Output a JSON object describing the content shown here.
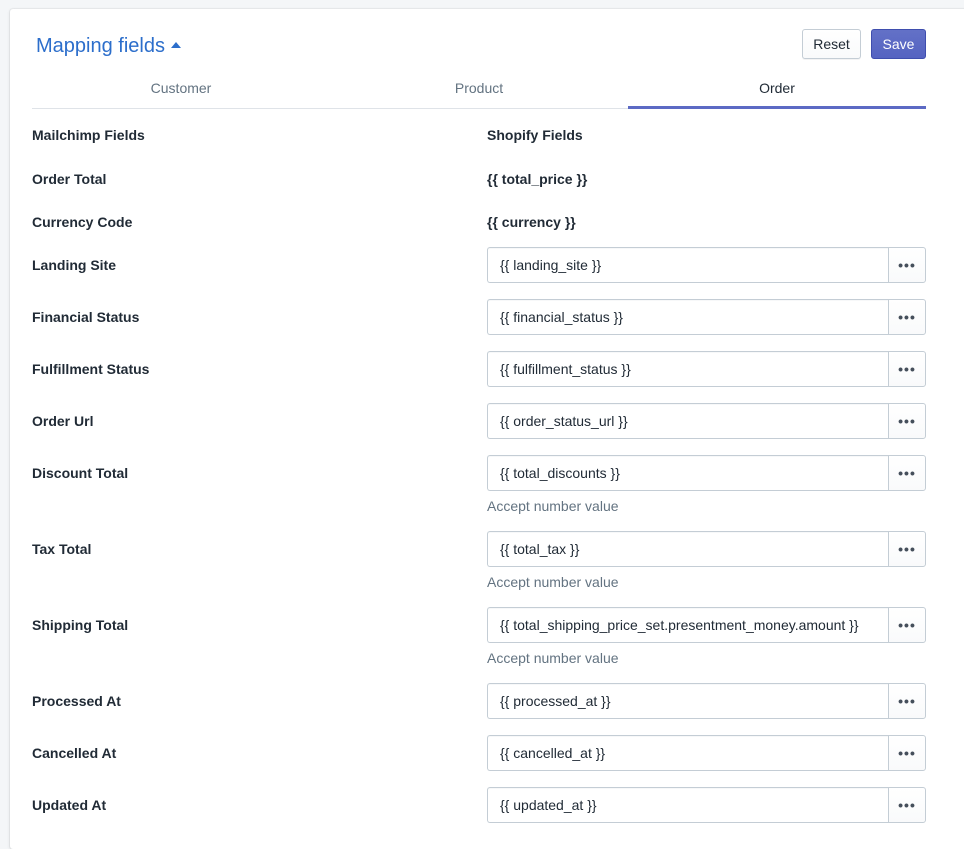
{
  "header": {
    "title": "Mapping fields",
    "reset_label": "Reset",
    "save_label": "Save"
  },
  "tabs": [
    {
      "label": "Customer",
      "active": false
    },
    {
      "label": "Product",
      "active": false
    },
    {
      "label": "Order",
      "active": true
    }
  ],
  "columns": {
    "left": "Mailchimp Fields",
    "right": "Shopify Fields"
  },
  "static_rows": [
    {
      "label": "Order Total",
      "value": "{{ total_price }}"
    },
    {
      "label": "Currency Code",
      "value": "{{ currency }}"
    }
  ],
  "input_rows": [
    {
      "label": "Landing Site",
      "value": "{{ landing_site }}",
      "help": ""
    },
    {
      "label": "Financial Status",
      "value": "{{ financial_status }}",
      "help": ""
    },
    {
      "label": "Fulfillment Status",
      "value": "{{ fulfillment_status }}",
      "help": ""
    },
    {
      "label": "Order Url",
      "value": "{{ order_status_url }}",
      "help": ""
    },
    {
      "label": "Discount Total",
      "value": "{{ total_discounts }}",
      "help": "Accept number value"
    },
    {
      "label": "Tax Total",
      "value": "{{ total_tax }}",
      "help": "Accept number value"
    },
    {
      "label": "Shipping Total",
      "value": "{{ total_shipping_price_set.presentment_money.amount }}",
      "help": "Accept number value"
    },
    {
      "label": "Processed At",
      "value": "{{ processed_at }}",
      "help": ""
    },
    {
      "label": "Cancelled At",
      "value": "{{ cancelled_at }}",
      "help": ""
    },
    {
      "label": "Updated At",
      "value": "{{ updated_at }}",
      "help": ""
    }
  ],
  "icons": {
    "more_button": "ellipsis-icon",
    "title_toggle": "caret-up-icon"
  },
  "colors": {
    "accent": "#5c6ac4",
    "link": "#2c6ecb"
  }
}
